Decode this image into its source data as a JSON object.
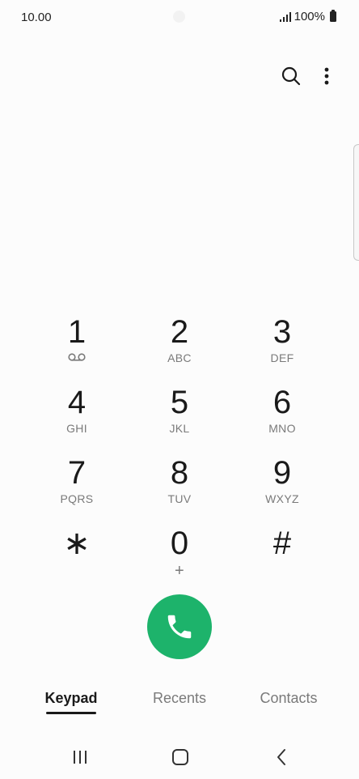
{
  "status_bar": {
    "time": "10.00",
    "battery": "100%",
    "signal_icon": "signal-bars-icon",
    "battery_icon": "battery-icon"
  },
  "toolbar": {
    "search_icon": "search-icon",
    "more_icon": "more-vertical-icon"
  },
  "keypad": {
    "keys": [
      {
        "digit": "1",
        "letters": "",
        "icon": "voicemail-icon"
      },
      {
        "digit": "2",
        "letters": "ABC"
      },
      {
        "digit": "3",
        "letters": "DEF"
      },
      {
        "digit": "4",
        "letters": "GHI"
      },
      {
        "digit": "5",
        "letters": "JKL"
      },
      {
        "digit": "6",
        "letters": "MNO"
      },
      {
        "digit": "7",
        "letters": "PQRS"
      },
      {
        "digit": "8",
        "letters": "TUV"
      },
      {
        "digit": "9",
        "letters": "WXYZ"
      },
      {
        "digit": "∗",
        "letters": ""
      },
      {
        "digit": "0",
        "letters": "+"
      },
      {
        "digit": "#",
        "letters": ""
      }
    ]
  },
  "call_button": {
    "icon": "phone-icon",
    "color": "#1db36b"
  },
  "tabs": [
    {
      "label": "Keypad",
      "active": true
    },
    {
      "label": "Recents",
      "active": false
    },
    {
      "label": "Contacts",
      "active": false
    }
  ],
  "nav_bar": {
    "recents_icon": "recent-apps-icon",
    "home_icon": "home-icon",
    "back_icon": "back-icon"
  }
}
